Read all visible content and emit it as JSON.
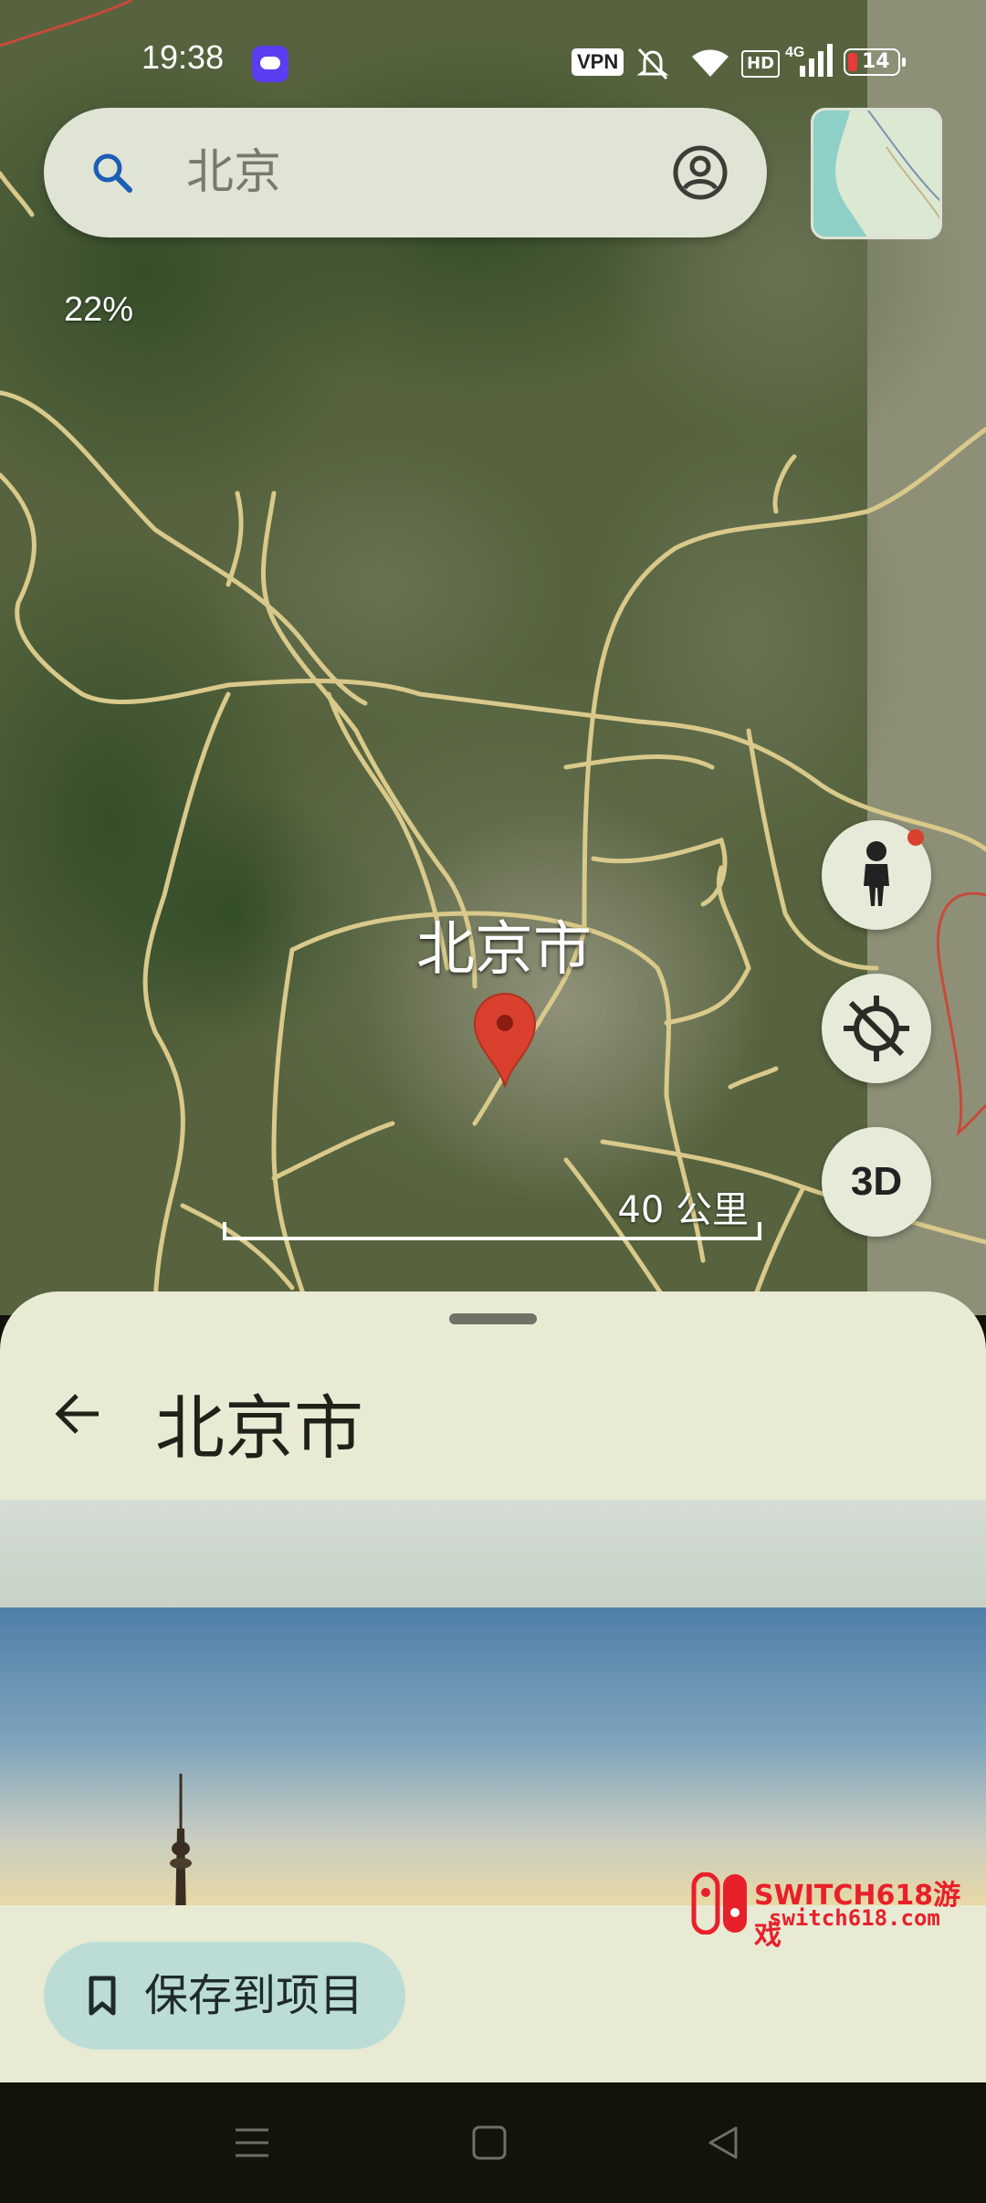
{
  "status_bar": {
    "time": "19:38",
    "vpn": "VPN",
    "hd": "HD",
    "network": "4G",
    "battery": "14"
  },
  "search": {
    "value": "北京"
  },
  "map": {
    "percent": "22%",
    "city_label": "北京市",
    "scale_label": "40 公里",
    "three_d_label": "3D"
  },
  "place": {
    "title": "北京市",
    "save_label": "保存到项目"
  },
  "watermark": {
    "line1": "SWITCH618游戏",
    "line2": "switch618.com"
  },
  "colors": {
    "sheet": "#e8ead4",
    "accent_pin": "#d9402e",
    "save_chip": "#bcdcd6"
  }
}
